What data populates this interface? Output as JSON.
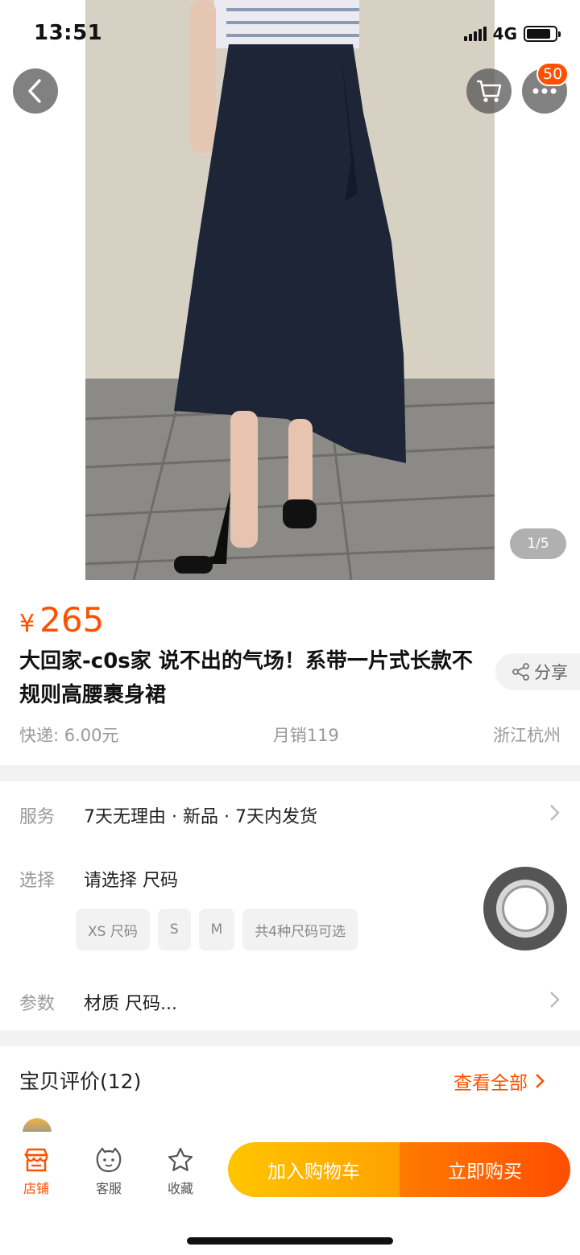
{
  "status_bar": {
    "time": "13:51",
    "network": "4G",
    "battery_level": 0.85
  },
  "gallery": {
    "page_indicator": "1/5"
  },
  "header": {
    "more_badge": "50"
  },
  "product": {
    "currency": "¥",
    "price": "265",
    "title": "大回家-c0s家  说不出的气场！系带一片式长款不规则高腰裹身裙",
    "share_label": "分享",
    "shipping": "快递: 6.00元",
    "monthly_sales": "月销119",
    "location": "浙江杭州"
  },
  "options": {
    "service_label": "服务",
    "service_value": "7天无理由 · 新品 · 7天内发货",
    "select_label": "选择",
    "select_value": "请选择 尺码",
    "size_chips": [
      "XS 尺码",
      "S",
      "M",
      "共4种尺码可选"
    ],
    "params_label": "参数",
    "params_value": "材质 尺码..."
  },
  "reviews": {
    "title": "宝贝评价(12)",
    "view_all": "查看全部"
  },
  "bottom_bar": {
    "shop": "店铺",
    "service": "客服",
    "favorite": "收藏",
    "add_to_cart": "加入购物车",
    "buy_now": "立即购买"
  },
  "colors": {
    "accent": "#ff5000",
    "cart_button": "#ffb300",
    "buy_button": "#ff5a00"
  },
  "icons": [
    "back-icon",
    "cart-icon",
    "more-icon",
    "share-icon",
    "chevron-right-icon",
    "shop-icon",
    "service-icon",
    "star-icon",
    "assist-ball-icon"
  ]
}
